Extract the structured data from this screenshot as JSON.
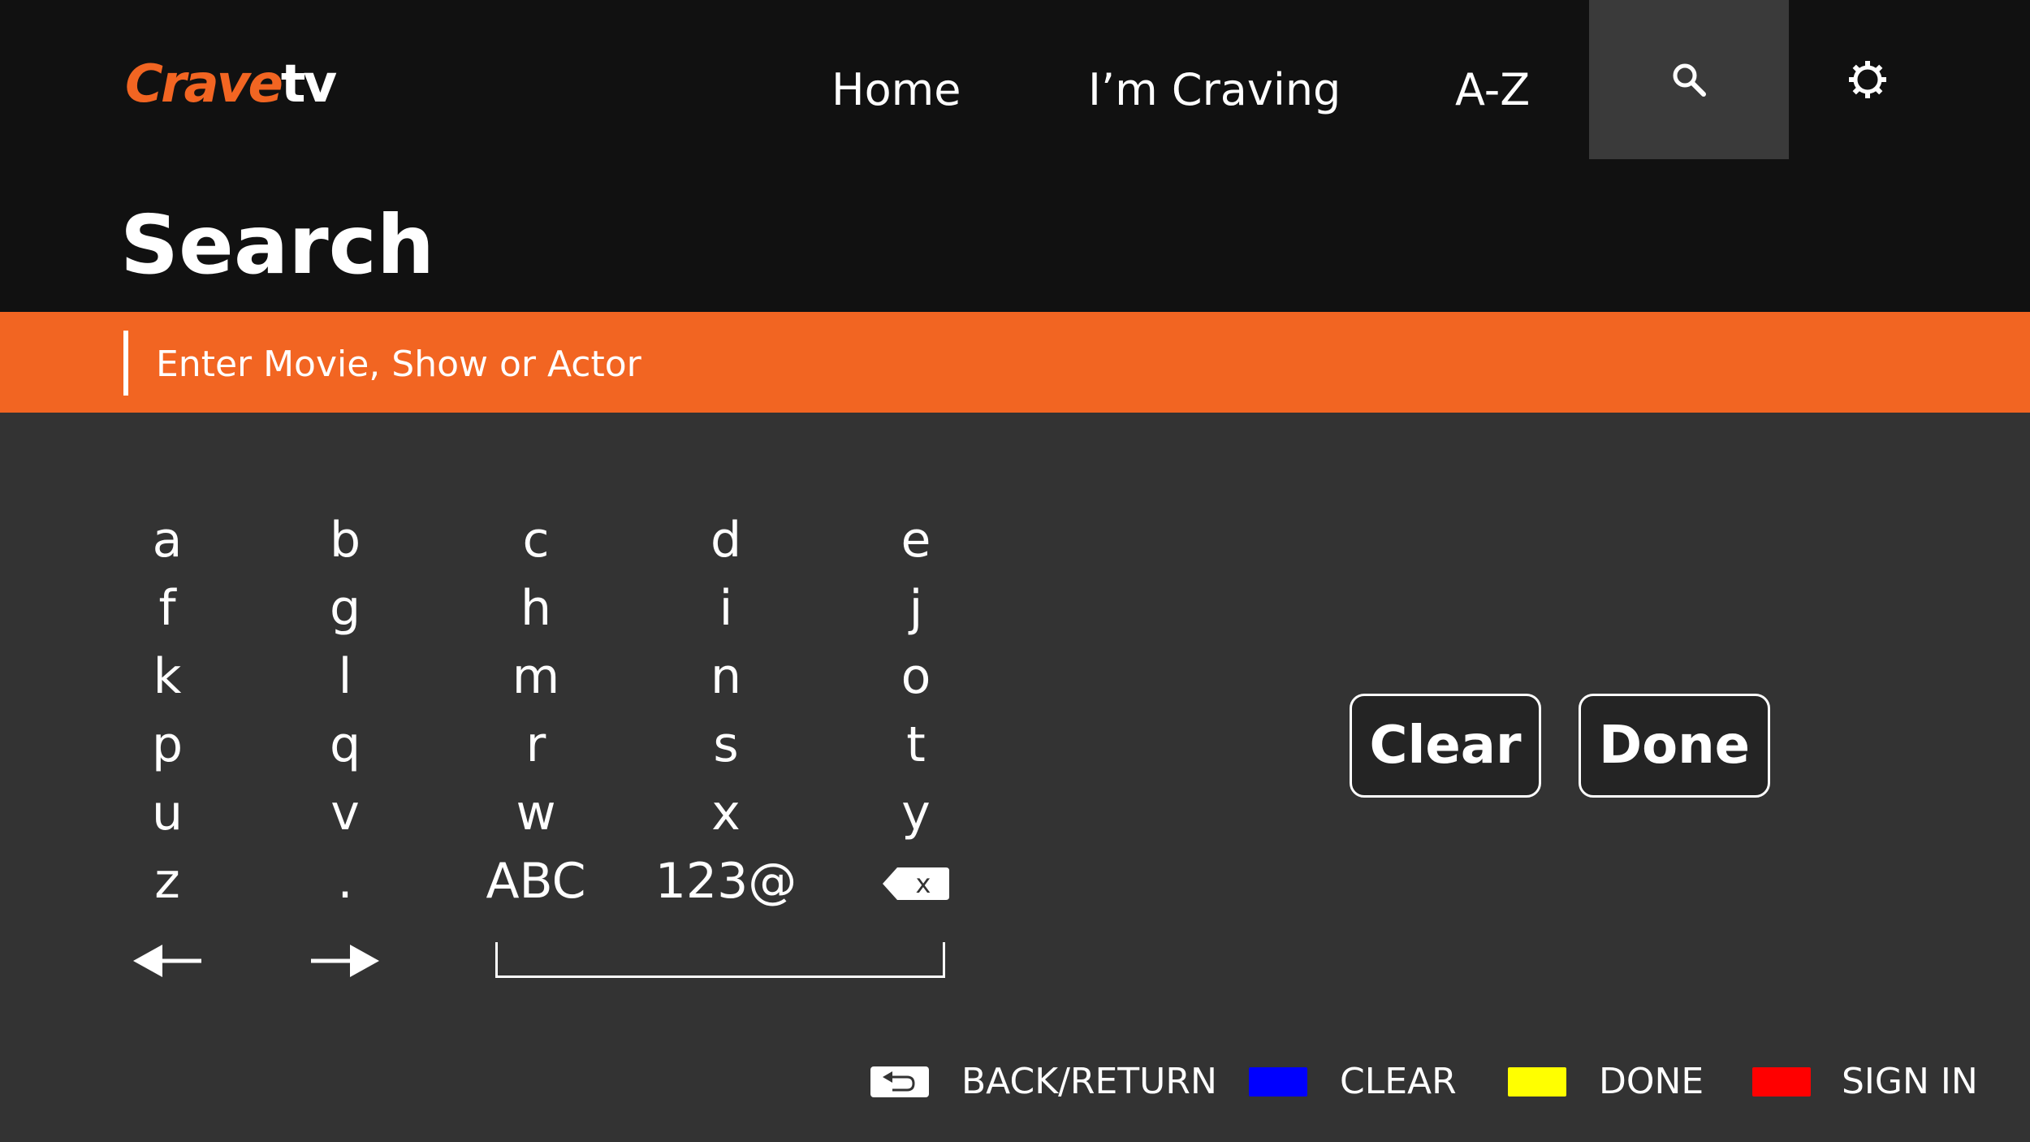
{
  "header": {
    "logo": {
      "part1": "Crave",
      "part2": "tv"
    },
    "nav": [
      {
        "label": "Home"
      },
      {
        "label": "I’m Craving"
      },
      {
        "label": "A-Z"
      }
    ],
    "search_icon": "search-icon",
    "settings_icon": "gear-icon"
  },
  "page": {
    "title": "Search"
  },
  "search": {
    "placeholder": "Enter Movie, Show or Actor",
    "value": ""
  },
  "keyboard": {
    "rows": [
      [
        "a",
        "b",
        "c",
        "d",
        "e"
      ],
      [
        "f",
        "g",
        "h",
        "i",
        "j"
      ],
      [
        "k",
        "l",
        "m",
        "n",
        "o"
      ],
      [
        "p",
        "q",
        "r",
        "s",
        "t"
      ],
      [
        "u",
        "v",
        "w",
        "x",
        "y"
      ],
      [
        "z",
        ".",
        "ABC",
        "123@",
        "backspace-icon"
      ]
    ],
    "backspace_glyph": "x",
    "arrows": [
      "arrow-left-icon",
      "arrow-right-icon"
    ],
    "space": "space-key"
  },
  "actions": {
    "clear": "Clear",
    "done": "Done"
  },
  "legend": [
    {
      "icon": "back-return-icon",
      "label": "BACK/RETURN",
      "color": "#ffffff"
    },
    {
      "icon": "blue-key",
      "label": "CLEAR",
      "color": "#0000ff"
    },
    {
      "icon": "yellow-key",
      "label": "DONE",
      "color": "#ffff00"
    },
    {
      "icon": "red-key",
      "label": "SIGN IN",
      "color": "#ff0000"
    }
  ],
  "colors": {
    "accent": "#f26522",
    "header_bg": "#111111",
    "body_bg": "#333333"
  }
}
